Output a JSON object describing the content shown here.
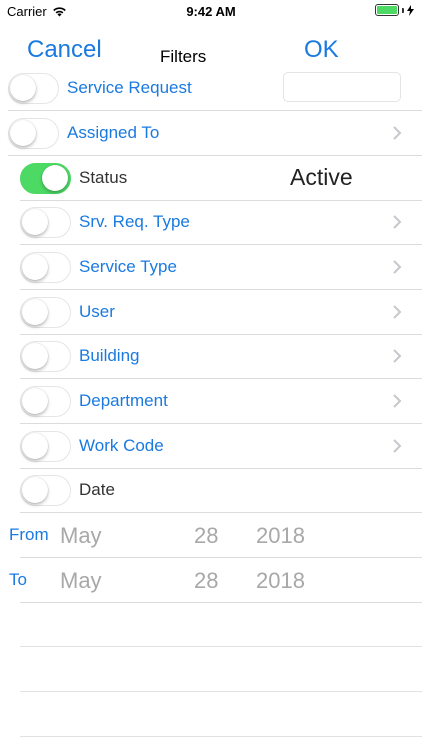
{
  "status_bar": {
    "carrier": "Carrier",
    "time": "9:42 AM",
    "battery_level": 1.0
  },
  "nav": {
    "cancel_label": "Cancel",
    "title": "Filters",
    "ok_label": "OK"
  },
  "filters": [
    {
      "label": "Service Request",
      "enabled": false,
      "has_input": true
    },
    {
      "label": "Assigned To",
      "enabled": false,
      "has_chevron": true
    },
    {
      "label": "Status",
      "enabled": true,
      "value": "Active"
    },
    {
      "label": "Srv. Req. Type",
      "enabled": false,
      "has_chevron": true
    },
    {
      "label": "Service Type",
      "enabled": false,
      "has_chevron": true
    },
    {
      "label": "User",
      "enabled": false,
      "has_chevron": true
    },
    {
      "label": "Building",
      "enabled": false,
      "has_chevron": true
    },
    {
      "label": "Department",
      "enabled": false,
      "has_chevron": true
    },
    {
      "label": "Work Code",
      "enabled": false,
      "has_chevron": true
    },
    {
      "label": "Date",
      "enabled": false
    }
  ],
  "date_range": {
    "from": {
      "label": "From",
      "month": "May",
      "day": "28",
      "year": "2018"
    },
    "to": {
      "label": "To",
      "month": "May",
      "day": "28",
      "year": "2018"
    }
  },
  "colors": {
    "accent": "#1a7ae0",
    "toggle_on": "#4cd964",
    "separator": "#dcdcdc"
  },
  "icons": {
    "wifi": "wifi-icon",
    "battery": "battery-icon",
    "charging": "charging-bolt-icon",
    "chevron": "chevron-right-icon"
  }
}
